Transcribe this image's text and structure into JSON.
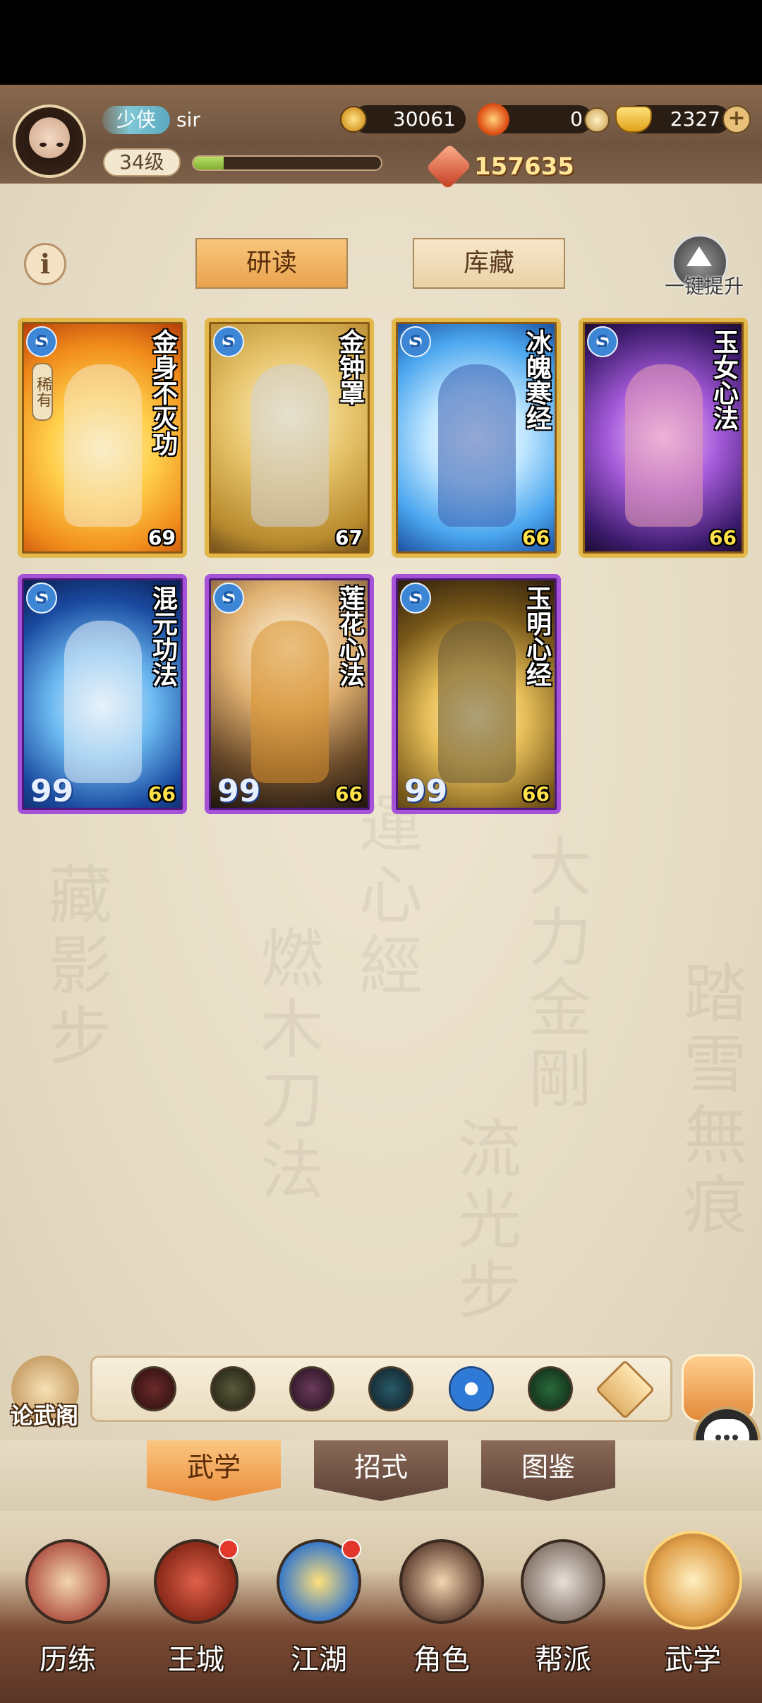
{
  "player": {
    "rank": "少侠",
    "name": "sir",
    "level": "34级",
    "exp_fraction": 0.16,
    "power": "157635"
  },
  "resources": {
    "coins": "30061",
    "tokens": "0",
    "gold": "2327"
  },
  "icons": {
    "avatar": "player-avatar",
    "coin": "copper-coin-icon",
    "token": "flame-token-icon",
    "gold": "gold-ingot-icon",
    "add": "plus-icon",
    "power": "power-gem-icon",
    "info": "info-icon",
    "upgrade": "upgrade-arrow-icon",
    "chat": "chat-bubble-icon"
  },
  "top_tabs": {
    "study": "研读",
    "collection": "库藏"
  },
  "info_symbol": "i",
  "one_key_upgrade": "一键提升",
  "cards": [
    {
      "title": "金身不灭功",
      "level": "69",
      "frame": "gold",
      "rare_tag": "稀有",
      "bottom_mark": ""
    },
    {
      "title": "金钟罩",
      "level": "67",
      "frame": "gold",
      "rare_tag": "",
      "bottom_mark": ""
    },
    {
      "title": "冰魄寒经",
      "level": "66",
      "frame": "gold",
      "rare_tag": "",
      "bottom_mark": ""
    },
    {
      "title": "玉女心法",
      "level": "66",
      "frame": "gold",
      "rare_tag": "",
      "bottom_mark": ""
    },
    {
      "title": "混元功法",
      "level": "66",
      "frame": "purple",
      "rare_tag": "",
      "bottom_mark": "99"
    },
    {
      "title": "莲花心法",
      "level": "66",
      "frame": "purple",
      "rare_tag": "",
      "bottom_mark": "99"
    },
    {
      "title": "玉明心经",
      "level": "66",
      "frame": "purple",
      "rare_tag": "",
      "bottom_mark": "99"
    }
  ],
  "card_badge_symbol": "S",
  "left_side_button": "论武阁",
  "filter_icons": [
    "sword-filter-icon",
    "dagger-filter-icon",
    "fist-filter-icon",
    "palm-filter-icon",
    "taiji-filter-icon",
    "healing-filter-icon",
    "all-filter-icon"
  ],
  "sub_tabs": {
    "martial": "武学",
    "moves": "招式",
    "atlas": "图鉴"
  },
  "nav": [
    {
      "label": "历练",
      "badge": false
    },
    {
      "label": "王城",
      "badge": true
    },
    {
      "label": "江湖",
      "badge": true
    },
    {
      "label": "角色",
      "badge": false
    },
    {
      "label": "帮派",
      "badge": false
    },
    {
      "label": "武学",
      "badge": false
    }
  ],
  "colors": {
    "gold_frame": "#e2b84a",
    "purple_frame": "#a552d8",
    "active_tab": "#e9a24e",
    "notification": "#e3372b"
  }
}
